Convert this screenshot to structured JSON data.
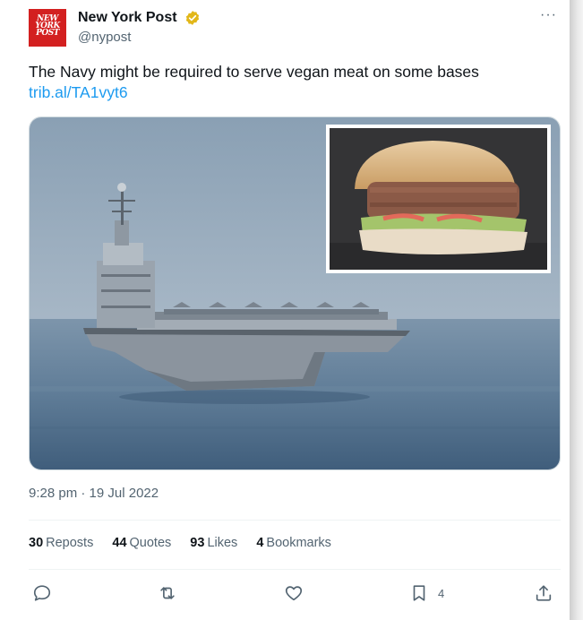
{
  "account": {
    "avatar_lines": [
      "NEW",
      "YORK",
      "POST"
    ],
    "name": "New York Post",
    "handle": "@nypost",
    "more_label": "···"
  },
  "tweet": {
    "text": "The Navy might be required to serve vegan meat on some bases",
    "link": "trib.al/TA1vyt6",
    "timestamp": "9:28 pm · 19 Jul 2022"
  },
  "stats": {
    "reposts_count": "30",
    "reposts_label": "Reposts",
    "quotes_count": "44",
    "quotes_label": "Quotes",
    "likes_count": "93",
    "likes_label": "Likes",
    "bookmarks_count": "4",
    "bookmarks_label": "Bookmarks"
  },
  "actions": {
    "reply_icon": "reply-icon",
    "repost_icon": "repost-icon",
    "like_icon": "heart-icon",
    "bookmark_icon": "bookmark-icon",
    "bookmark_count": "4",
    "share_icon": "share-icon"
  },
  "media": {
    "main_image": "aircraft carrier at sea",
    "inset_image": "vegan burger"
  },
  "colors": {
    "link": "#1d9bf0",
    "secondary_text": "#536471",
    "verified_badge": "#e2b719",
    "avatar_red": "#d32020"
  }
}
